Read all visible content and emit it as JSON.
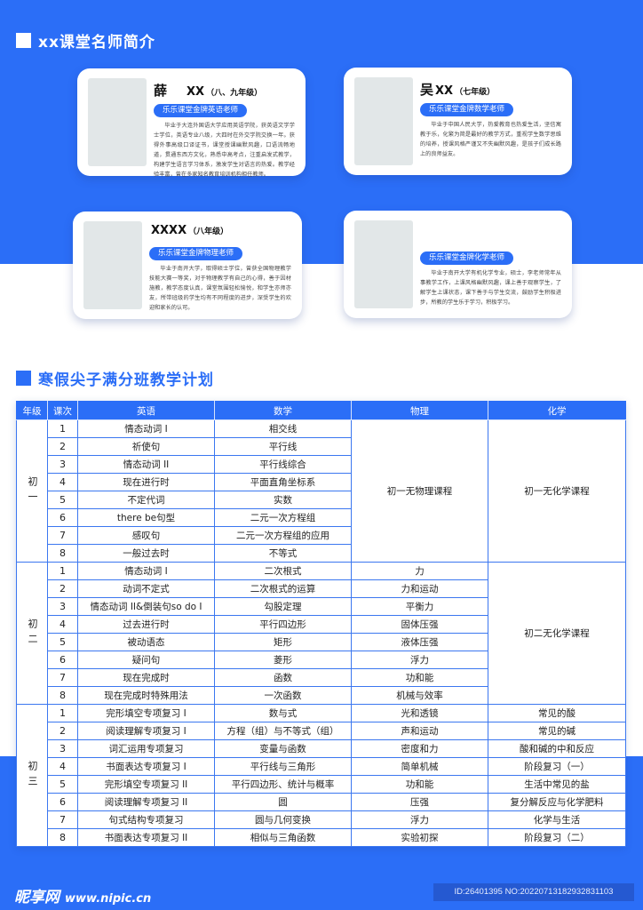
{
  "section1": {
    "title": "xx课堂名师简介"
  },
  "teachers": [
    {
      "surname": "薛",
      "name": "XX",
      "grade": "（八、九年级）",
      "badge": "乐乐课堂金牌英语老师",
      "desc": "毕业于大连外国语大学应用英语学院，获英语文学学士学位，英语专业八级，大四时在外交学院交换一年。获得外事高级口译证书，课堂授课幽默风趣，口语流畅地道，贯通东西方文化，熟悉中高考点，注重启发式教学，构建学生语言学习体系，激发学生对语言的热爱。教学经验丰富，曾在多家知名教育培训机构担任教师。"
    },
    {
      "surname": "吴",
      "name": "XX",
      "grade": "（七年级）",
      "badge": "乐乐课堂金牌数学老师",
      "desc": "毕业于中国人民大学，热爱教育也热爱生活，坚信寓教于乐，化繁为简是最好的教学方式，重视学生数学思维的培养，授课风格严谨又不失幽默风趣，是孩子们成长路上的良师益友。"
    },
    {
      "surname": "",
      "name": "XXXX",
      "grade": "（八年级）",
      "badge": "乐乐课堂金牌物理老师",
      "desc": "毕业于南开大学，取得硕士学位，曾获全国物理教学技能大赛一等奖，对于物理教学有自己的心得，善于因材施教，教学态度认真，课堂氛围轻松愉悦，和学生亦师亦友，所带班级的学生均有不同程度的进步，深受学生的欢迎和家长的认可。"
    },
    {
      "surname": "",
      "name": "",
      "grade": "",
      "badge": "乐乐课堂金牌化学老师",
      "desc": "毕业于南开大学有机化学专业，硕士，李老师常年从事教学工作，上课风格幽默风趣，课上善于观察学生，了解学生上课状态，课下善于与学生交流，鼓励学生积极进步，所教的学生乐于学习，积极学习。"
    }
  ],
  "section2": {
    "title": "寒假尖子满分班教学计划"
  },
  "table": {
    "headers": [
      "年级",
      "课次",
      "英语",
      "数学",
      "物理",
      "化学"
    ],
    "grades": [
      {
        "label": "初一",
        "physics_merged": "初一无物理课程",
        "chemistry_merged": "初一无化学课程",
        "rows": [
          {
            "n": "1",
            "english": "情态动词 I",
            "math": "相交线"
          },
          {
            "n": "2",
            "english": "祈使句",
            "math": "平行线"
          },
          {
            "n": "3",
            "english": "情态动词 II",
            "math": "平行线综合"
          },
          {
            "n": "4",
            "english": "现在进行时",
            "math": "平面直角坐标系"
          },
          {
            "n": "5",
            "english": "不定代词",
            "math": "实数"
          },
          {
            "n": "6",
            "english": "there be句型",
            "math": "二元一次方程组"
          },
          {
            "n": "7",
            "english": "感叹句",
            "math": "二元一次方程组的应用"
          },
          {
            "n": "8",
            "english": "一般过去时",
            "math": "不等式"
          }
        ]
      },
      {
        "label": "初二",
        "chemistry_merged": "初二无化学课程",
        "rows": [
          {
            "n": "1",
            "english": "情态动词 I",
            "math": "二次根式",
            "physics": "力"
          },
          {
            "n": "2",
            "english": "动词不定式",
            "math": "二次根式的运算",
            "physics": "力和运动"
          },
          {
            "n": "3",
            "english": "情态动词 II&倒装句so do I",
            "math": "勾股定理",
            "physics": "平衡力"
          },
          {
            "n": "4",
            "english": "过去进行时",
            "math": "平行四边形",
            "physics": "固体压强"
          },
          {
            "n": "5",
            "english": "被动语态",
            "math": "矩形",
            "physics": "液体压强"
          },
          {
            "n": "6",
            "english": "疑问句",
            "math": "菱形",
            "physics": "浮力"
          },
          {
            "n": "7",
            "english": "现在完成时",
            "math": "函数",
            "physics": "功和能"
          },
          {
            "n": "8",
            "english": "现在完成时特殊用法",
            "math": "一次函数",
            "physics": "机械与效率"
          }
        ]
      },
      {
        "label": "初三",
        "rows": [
          {
            "n": "1",
            "english": "完形填空专项复习 I",
            "math": "数与式",
            "physics": "光和透镜",
            "chemistry": "常见的酸"
          },
          {
            "n": "2",
            "english": "阅读理解专项复习 I",
            "math": "方程（组）与不等式（组）",
            "physics": "声和运动",
            "chemistry": "常见的碱"
          },
          {
            "n": "3",
            "english": "词汇运用专项复习",
            "math": "变量与函数",
            "physics": "密度和力",
            "chemistry": "酸和碱的中和反应"
          },
          {
            "n": "4",
            "english": "书面表达专项复习 I",
            "math": "平行线与三角形",
            "physics": "简单机械",
            "chemistry": "阶段复习（一）"
          },
          {
            "n": "5",
            "english": "完形填空专项复习 II",
            "math": "平行四边形、统计与概率",
            "physics": "功和能",
            "chemistry": "生活中常见的盐"
          },
          {
            "n": "6",
            "english": "阅读理解专项复习 II",
            "math": "圆",
            "physics": "压强",
            "chemistry": "复分解反应与化学肥料"
          },
          {
            "n": "7",
            "english": "句式结构专项复习",
            "math": "圆与几何变换",
            "physics": "浮力",
            "chemistry": "化学与生活"
          },
          {
            "n": "8",
            "english": "书面表达专项复习 II",
            "math": "相似与三角函数",
            "physics": "实验初探",
            "chemistry": "阶段复习（二）"
          }
        ]
      }
    ]
  },
  "footer": {
    "logo": "昵享网",
    "site": "www.nipic.cn",
    "id_text": "ID:26401395 NO:20220713182932831103"
  },
  "colors": {
    "brand_blue": "#2b6ef7",
    "photo_placeholder": "#e2e7e8"
  }
}
